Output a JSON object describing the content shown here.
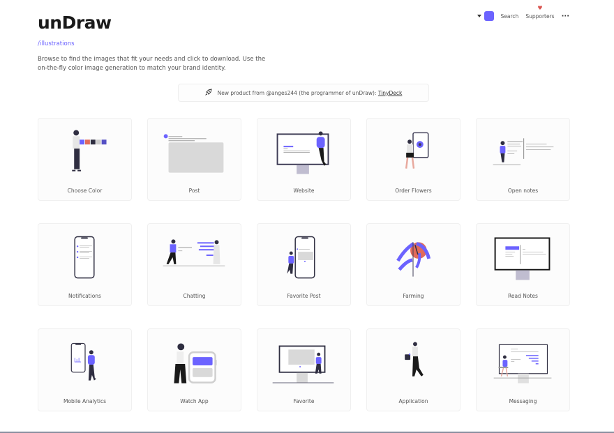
{
  "header": {
    "logo": "unDraw",
    "subtitle": "/illustrations",
    "description": "Browse to find the images that fit your needs and click to download. Use the on-the-fly color image generation to match your brand identity."
  },
  "topnav": {
    "color_icon": "caret-down-icon",
    "selected_color": "#6c63ff",
    "search_label": "Search",
    "supporters_label": "Supporters",
    "supporters_icon": "heart-icon",
    "more_icon": "more-icon",
    "more_label": "···"
  },
  "banner": {
    "icon": "rocket-icon",
    "text": "New product from @anges244 (the programmer of unDraw): ",
    "link_label": "TinyDeck"
  },
  "colors": {
    "accent": "#6c63ff",
    "dark": "#2f2e41",
    "gray": "#d6d6d6",
    "red": "#e26b5a"
  },
  "illustrations": [
    {
      "title": "Choose Color"
    },
    {
      "title": "Post"
    },
    {
      "title": "Website"
    },
    {
      "title": "Order Flowers"
    },
    {
      "title": "Open notes"
    },
    {
      "title": "Notifications"
    },
    {
      "title": "Chatting"
    },
    {
      "title": "Favorite Post"
    },
    {
      "title": "Farming"
    },
    {
      "title": "Read Notes"
    },
    {
      "title": "Mobile Analytics"
    },
    {
      "title": "Watch App"
    },
    {
      "title": "Favorite"
    },
    {
      "title": "Application"
    },
    {
      "title": "Messaging"
    }
  ]
}
